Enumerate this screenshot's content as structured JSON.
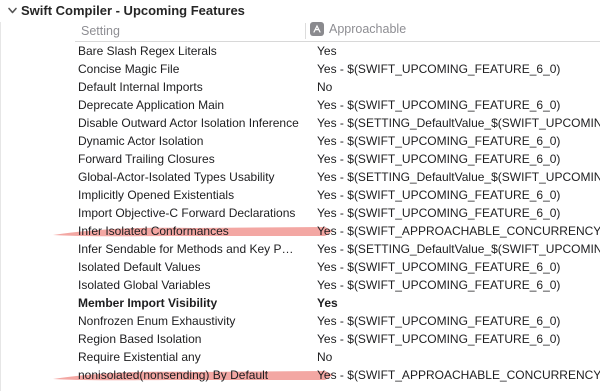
{
  "section": {
    "title": "Swift Compiler - Upcoming Features"
  },
  "columns": {
    "setting": "Setting",
    "approachable": "Approachable"
  },
  "rows": [
    {
      "name": "Bare Slash Regex Literals",
      "value": "Yes",
      "detail": ""
    },
    {
      "name": "Concise Magic File",
      "value": "Yes",
      "detail": "$(SWIFT_UPCOMING_FEATURE_6_0)"
    },
    {
      "name": "Default Internal Imports",
      "value": "No",
      "detail": ""
    },
    {
      "name": "Deprecate Application Main",
      "value": "Yes",
      "detail": "$(SWIFT_UPCOMING_FEATURE_6_0)"
    },
    {
      "name": "Disable Outward Actor Isolation Inference",
      "value": "Yes",
      "detail": "$(SETTING_DefaultValue_$(SWIFT_UPCOMING"
    },
    {
      "name": "Dynamic Actor Isolation",
      "value": "Yes",
      "detail": "$(SWIFT_UPCOMING_FEATURE_6_0)"
    },
    {
      "name": "Forward Trailing Closures",
      "value": "Yes",
      "detail": "$(SWIFT_UPCOMING_FEATURE_6_0)"
    },
    {
      "name": "Global-Actor-Isolated Types Usability",
      "value": "Yes",
      "detail": "$(SETTING_DefaultValue_$(SWIFT_UPCOMING"
    },
    {
      "name": "Implicitly Opened Existentials",
      "value": "Yes",
      "detail": "$(SWIFT_UPCOMING_FEATURE_6_0)"
    },
    {
      "name": "Import Objective-C Forward Declarations",
      "value": "Yes",
      "detail": "$(SWIFT_UPCOMING_FEATURE_6_0)"
    },
    {
      "name": "Infer Isolated Conformances",
      "value": "Yes",
      "detail": "$(SWIFT_APPROACHABLE_CONCURRENCY)"
    },
    {
      "name": "Infer Sendable for Methods and Key Path Li...",
      "value": "Yes",
      "detail": "$(SETTING_DefaultValue_$(SWIFT_UPCOMING"
    },
    {
      "name": "Isolated Default Values",
      "value": "Yes",
      "detail": "$(SWIFT_UPCOMING_FEATURE_6_0)"
    },
    {
      "name": "Isolated Global Variables",
      "value": "Yes",
      "detail": "$(SWIFT_UPCOMING_FEATURE_6_0)"
    },
    {
      "name": "Member Import Visibility",
      "value": "Yes",
      "detail": ""
    },
    {
      "name": "Nonfrozen Enum Exhaustivity",
      "value": "Yes",
      "detail": "$(SWIFT_UPCOMING_FEATURE_6_0)"
    },
    {
      "name": "Region Based Isolation",
      "value": "Yes",
      "detail": "$(SWIFT_UPCOMING_FEATURE_6_0)"
    },
    {
      "name": "Require Existential any",
      "value": "No",
      "detail": ""
    },
    {
      "name": "nonisolated(nonsending) By Default",
      "value": "Yes",
      "detail": "$(SWIFT_APPROACHABLE_CONCURRENCY)"
    }
  ],
  "separator": "-",
  "colors": {
    "highlight": "#ef8a84",
    "text": "#1d1d1f",
    "secondary": "#8e8e93"
  }
}
